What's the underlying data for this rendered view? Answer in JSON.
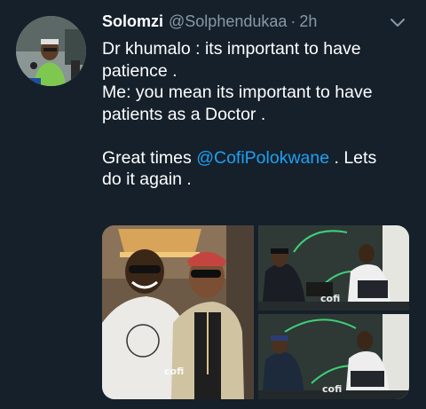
{
  "tweet": {
    "display_name": "Solomzi",
    "handle": "@Solphendukaa",
    "separator": "·",
    "time": "2h",
    "lines": [
      "Dr khumalo : its important to have",
      "patience .",
      "Me: you mean its important to have",
      "patients as a Doctor ."
    ],
    "final_prefix": "Great times ",
    "mention": "@CofiPolokwane",
    "final_suffix": " . Lets",
    "final_line2": "do it again ."
  },
  "media": {
    "watermark": "cofi",
    "count": 3
  },
  "colors": {
    "background": "#15202b",
    "text": "#ffffff",
    "muted": "#8899a6",
    "link": "#1da1f2"
  },
  "icons": {
    "more": "chevron-down-icon"
  }
}
